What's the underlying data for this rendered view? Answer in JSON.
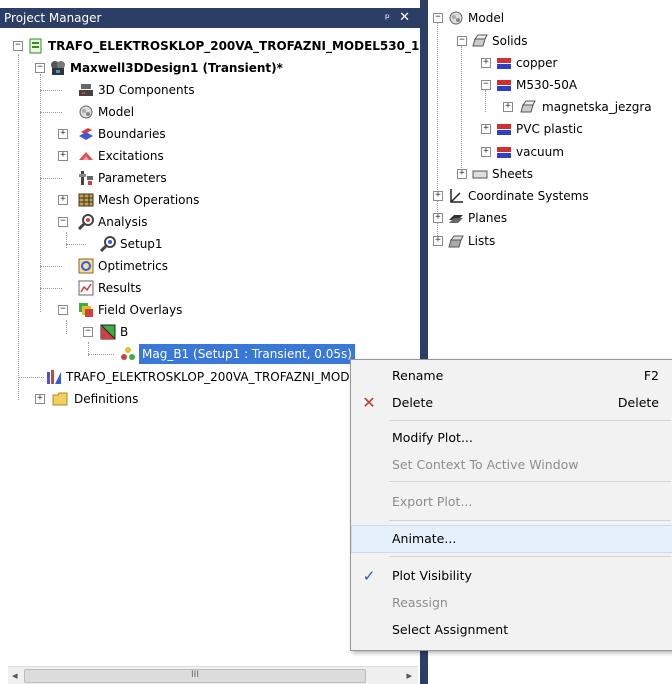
{
  "project_manager": {
    "title": "Project Manager",
    "pin_icon": "pin-icon",
    "close_icon": "close-icon",
    "tree": {
      "project": "TRAFO_ELEKTROSKLOP_200VA_TROFAZNI_MODEL530_1",
      "design": "Maxwell3DDesign1 (Transient)*",
      "items": {
        "components3d": "3D Components",
        "model": "Model",
        "boundaries": "Boundaries",
        "excitations": "Excitations",
        "parameters": "Parameters",
        "mesh_operations": "Mesh Operations",
        "analysis": "Analysis",
        "setup1": "Setup1",
        "optimetrics": "Optimetrics",
        "results": "Results",
        "field_overlays": "Field Overlays",
        "b": "B",
        "mag_b1": "Mag_B1 (Setup1 : Transient, 0.05s)"
      },
      "second_design": "TRAFO_ELEKTROSKLOP_200VA_TROFAZNI_MOD",
      "definitions": "Definitions"
    },
    "scrollbar_grip": "III"
  },
  "model_tree": {
    "model": "Model",
    "solids": "Solids",
    "copper": "copper",
    "m530": "M530-50A",
    "magnetska": "magnetska_jezgra",
    "pvc": "PVC plastic",
    "vacuum": "vacuum",
    "sheets": "Sheets",
    "coordinate_systems": "Coordinate Systems",
    "planes": "Planes",
    "lists": "Lists"
  },
  "context_menu": {
    "rename": "Rename",
    "rename_key": "F2",
    "delete": "Delete",
    "delete_key": "Delete",
    "modify_plot": "Modify Plot...",
    "set_context": "Set Context To Active Window",
    "export_plot": "Export Plot...",
    "animate": "Animate...",
    "plot_visibility": "Plot Visibility",
    "reassign": "Reassign",
    "select_assignment": "Select Assignment"
  },
  "colors": {
    "title_bar": "#2c3e66",
    "selection": "#3a78d8",
    "menu_bg": "#f2f2f2",
    "delete_x": "#c0392b",
    "check": "#2a5db0"
  }
}
